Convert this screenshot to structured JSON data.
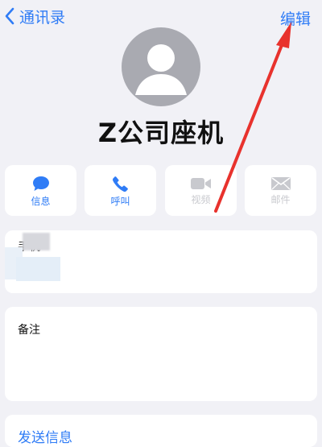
{
  "nav": {
    "back_label": "通讯录",
    "edit_label": "编辑"
  },
  "contact": {
    "name": "Z公司座机"
  },
  "actions": [
    {
      "label": "信息",
      "icon": "message-bubble-icon",
      "enabled": true
    },
    {
      "label": "呼叫",
      "icon": "phone-icon",
      "enabled": true
    },
    {
      "label": "视频",
      "icon": "video-camera-icon",
      "enabled": false
    },
    {
      "label": "邮件",
      "icon": "mail-envelope-icon",
      "enabled": false
    }
  ],
  "fields": {
    "phone_label": "手机",
    "notes_label": "备注"
  },
  "send_message_label": "发送信息",
  "colors": {
    "accent": "#2f7cf6",
    "disabled": "#c8c9ce",
    "annotation_arrow": "#e8322d",
    "background": "#f1f1f6"
  }
}
